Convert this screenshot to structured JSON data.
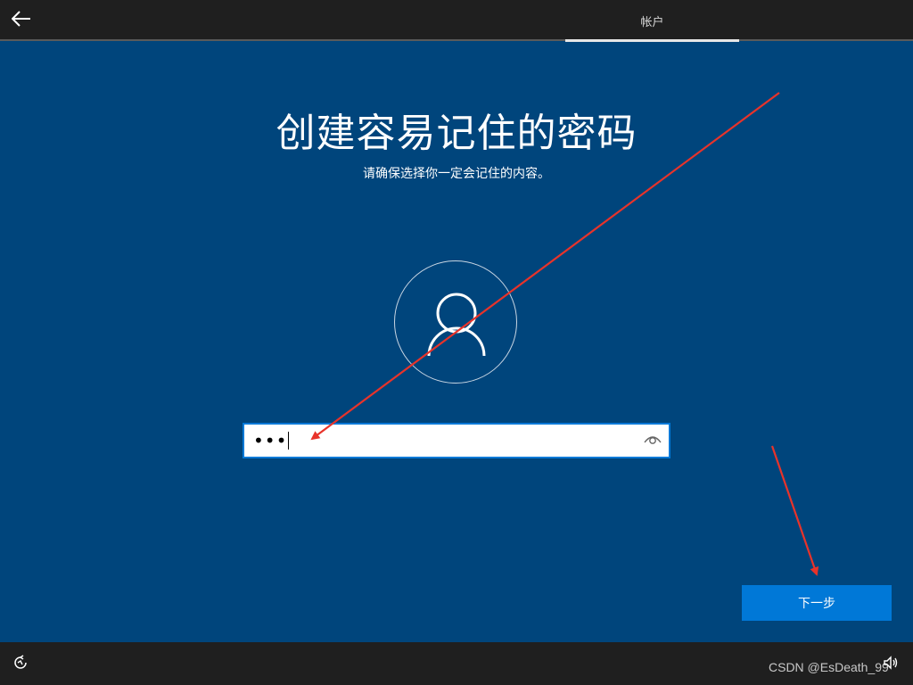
{
  "header": {
    "tab_label": "帐户"
  },
  "main": {
    "title": "创建容易记住的密码",
    "subtitle": "请确保选择你一定会记住的内容。",
    "password_value": "•••",
    "next_label": "下一步"
  },
  "footer": {
    "watermark": "CSDN @EsDeath_99"
  },
  "icons": {
    "back": "arrow-left-icon",
    "avatar": "user-icon",
    "reveal": "eye-icon",
    "ease_of_access": "ease-of-access-icon",
    "volume": "volume-icon"
  },
  "colors": {
    "background": "#00457c",
    "bar": "#1f1f1f",
    "accent": "#0078d7",
    "annotation": "#e8332a"
  }
}
